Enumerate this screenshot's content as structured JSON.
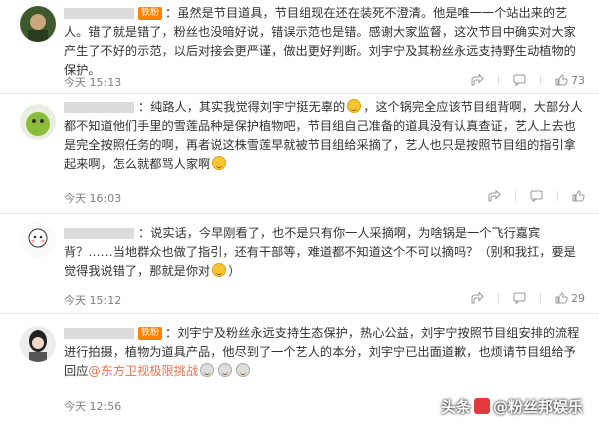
{
  "badge_label": "铁粉",
  "comments": [
    {
      "text_a": "：虽然是节目道具，节目组现在还在装死不澄清。他是唯一一个站出来的艺人。错了就是错了，粉丝也没暗好说，错误示范也是错。感谢大家监督，这次节目中确实对大家产生了不好的示范，以后对接会更严谨，做出更好判断。刘宇宁及其粉丝永远支持野生动植物的保护。",
      "time": "今天 15:13",
      "likes": "73"
    },
    {
      "text_a": "：纯路人，其实我觉得刘宇宁挺无辜的",
      "text_b": "，这个锅完全应该节目组背啊，大部分人都不知道他们手里的雪莲品种是保护植物吧，节目组自己准备的道具没有认真查证，艺人上去也是完全按照任务的啊，再者说这株雪莲早就被节目组给采摘了，艺人也只是按照节目组的指引拿起来啊，怎么就都骂人家啊",
      "time": "今天 16:03",
      "likes": ""
    },
    {
      "text_a": "：说实话，今早刚看了，也不是只有你一人采摘啊，为啥锅是一个飞行嘉宾背？……当地群众也做了指引，还有干部等，难道都不知道这个不可以摘吗？（别和我扛，要是觉得我说错了，那就是你对",
      "text_b": "）",
      "time": "今天 15:12",
      "likes": "29"
    },
    {
      "text_a": "：刘宇宁及粉丝永远支持生态保护，热心公益，刘宇宁按照节目组安排的流程进行拍摄，植物为道具产品，他尽到了一个艺人的本分，刘宇宁已出面道歉，也烦请节目组给予回应",
      "link": "@东方卫视极限挑战",
      "time": "今天 12:56",
      "likes": ""
    }
  ],
  "watermark": {
    "prefix": "头条",
    "account": "@粉丝邦娱乐"
  },
  "colors": {
    "badge": "#ff8200",
    "link": "#eb7350",
    "meta": "#808080"
  }
}
